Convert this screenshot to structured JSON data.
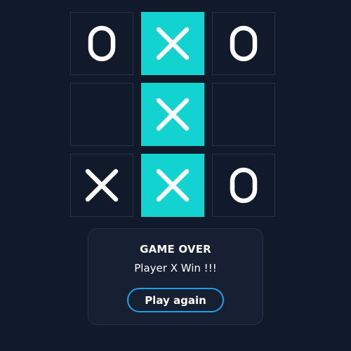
{
  "board": {
    "cells": [
      {
        "mark": "O",
        "win": false
      },
      {
        "mark": "X",
        "win": true
      },
      {
        "mark": "O",
        "win": false
      },
      {
        "mark": "",
        "win": false
      },
      {
        "mark": "X",
        "win": true
      },
      {
        "mark": "",
        "win": false
      },
      {
        "mark": "X",
        "win": false
      },
      {
        "mark": "X",
        "win": true
      },
      {
        "mark": "O",
        "win": false
      }
    ]
  },
  "result": {
    "title": "GAME OVER",
    "message": "Player X Win !!!",
    "play_again_label": "Play again"
  },
  "colors": {
    "background": "#111a2b",
    "win_cell": "#12d3cf",
    "mark": "#ffffff",
    "button_border": "#1ea2e5"
  }
}
